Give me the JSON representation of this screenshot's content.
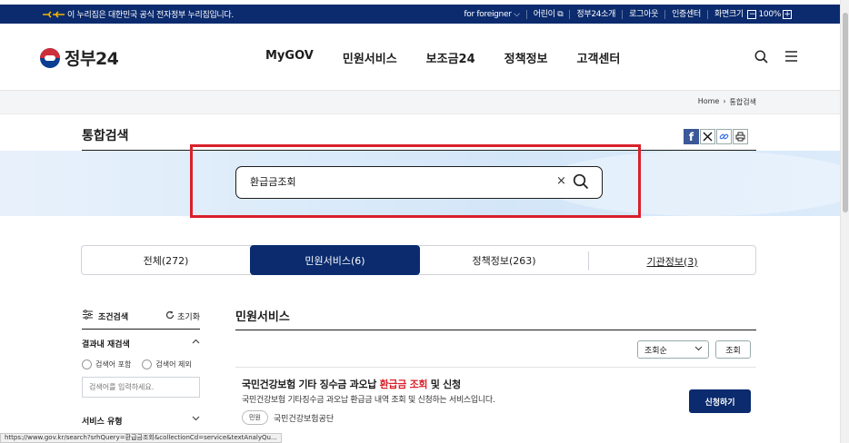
{
  "gov_bar": {
    "notice": "이 누리집은 대한민국 공식 전자정부 누리집입니다.",
    "links": [
      "for foreigner",
      "어린이",
      "정부24소개",
      "로그아웃",
      "인증센터",
      "화면크기"
    ],
    "zoom": "100%"
  },
  "header": {
    "logo_text": "정부24",
    "nav": [
      "MyGOV",
      "민원서비스",
      "보조금24",
      "정책정보",
      "고객센터"
    ]
  },
  "breadcrumb": [
    "Home",
    "통합검색"
  ],
  "page_title": "통합검색",
  "search": {
    "value": "환급금조회"
  },
  "tabs": [
    {
      "label": "전체(272)"
    },
    {
      "label": "민원서비스(6)"
    },
    {
      "label": "정책정보(263)"
    },
    {
      "label": "기관정보(3)"
    }
  ],
  "filter": {
    "title": "조건검색",
    "reset": "초기화",
    "within_results": "결과내 재검색",
    "include": "검색어 포함",
    "exclude": "검색어 제외",
    "placeholder": "검색어를 입력하세요.",
    "service_type": "서비스 유형"
  },
  "results": {
    "section_title": "민원서비스",
    "sort_selected": "조회순",
    "sort_button": "조회",
    "item": {
      "title_pre": "국민건강보험 기타 징수금 과오납 ",
      "title_hl": "환급금 조회",
      "title_post": " 및 신청",
      "desc": "국민건강보험 기타징수금 과오납 환급금 내역 조회 및 신청하는 서비스입니다.",
      "tag": "민원",
      "agency": "국민건강보험공단",
      "apply": "신청하기"
    }
  },
  "status_url": "https://www.gov.kr/search?srhQuery=환급금조회&collectionCd=service&textAnalyQu...",
  "colors": {
    "navy": "#0b2b6e",
    "highlight": "#d9202a"
  }
}
